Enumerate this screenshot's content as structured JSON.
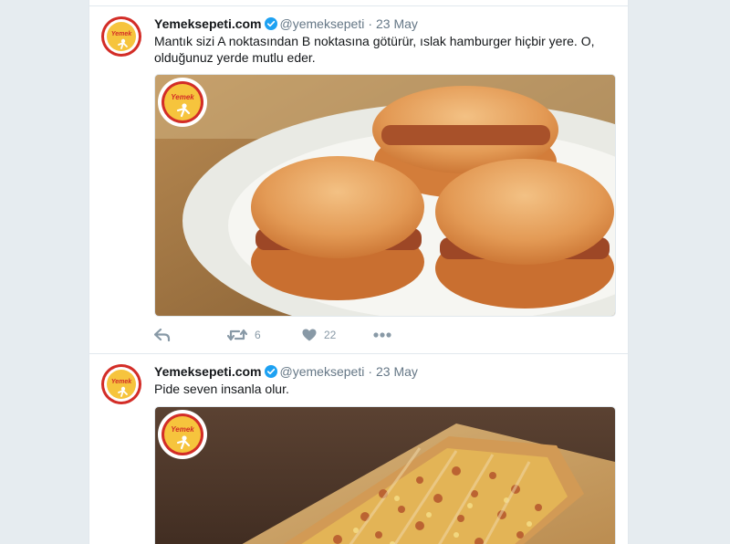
{
  "tweets": [
    {
      "display_name": "Yemeksepeti.com",
      "handle": "@yemeksepeti",
      "separator": "·",
      "date": "23 May",
      "text": "Mantık sizi A noktasından B noktasına götürür, ıslak hamburger hiçbir yere. O, olduğunuz yerde mutlu eder.",
      "media_subject": "islak-hamburger-photo",
      "retweet_count": "6",
      "like_count": "22"
    },
    {
      "display_name": "Yemeksepeti.com",
      "handle": "@yemeksepeti",
      "separator": "·",
      "date": "23 May",
      "text": "Pide seven insanla olur.",
      "media_subject": "pide-photo"
    }
  ],
  "icons": {
    "reply": "reply-icon",
    "retweet": "retweet-icon",
    "like": "heart-icon",
    "more": "more-icon",
    "verified": "verified-badge-icon"
  },
  "colors": {
    "brand_red": "#d32d27",
    "brand_yellow": "#f6c43d",
    "verified_blue": "#1da1f2",
    "action_gray": "#8899a6",
    "text_dark": "#14171a",
    "text_muted": "#657786"
  }
}
